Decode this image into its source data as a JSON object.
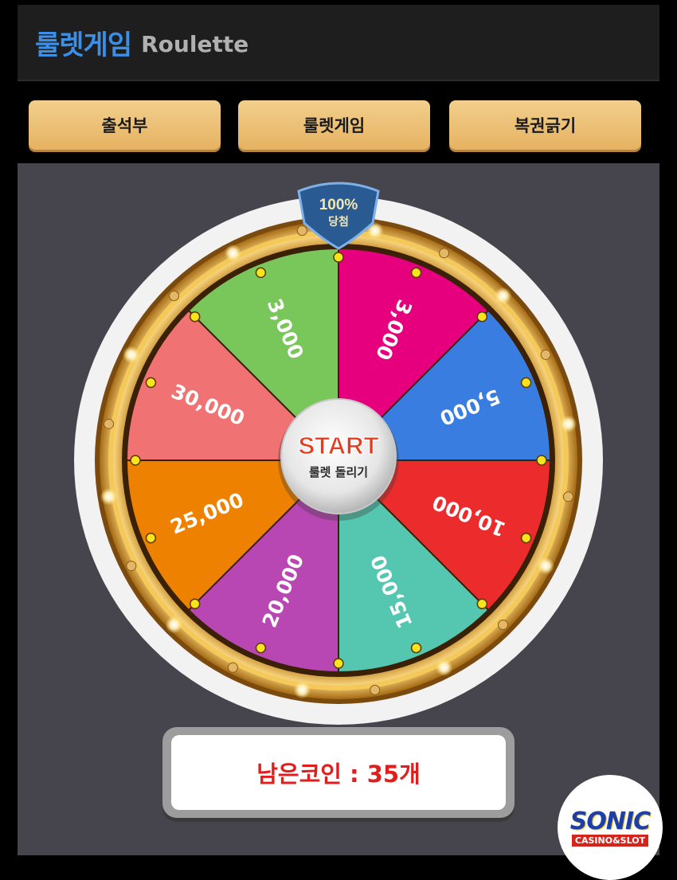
{
  "header": {
    "title_ko": "룰렛게임",
    "title_en": "Roulette"
  },
  "tabs": [
    {
      "label": "출석부"
    },
    {
      "label": "룰렛게임"
    },
    {
      "label": "복권긁기"
    }
  ],
  "wheel": {
    "badge_line1": "100%",
    "badge_line2": "당첨",
    "start_label": "START",
    "start_sub": "룰렛 돌리기",
    "segments": [
      {
        "label": "3,000",
        "color": "#e6007e"
      },
      {
        "label": "5,000",
        "color": "#3a7de0"
      },
      {
        "label": "10,000",
        "color": "#ec2c2c"
      },
      {
        "label": "15,000",
        "color": "#55c7b0"
      },
      {
        "label": "20,000",
        "color": "#b847b4"
      },
      {
        "label": "25,000",
        "color": "#ee8200"
      },
      {
        "label": "30,000",
        "color": "#f07272"
      },
      {
        "label": "3,000",
        "color": "#79c75a"
      }
    ]
  },
  "coins": {
    "label": "남은코인 : 35개"
  },
  "logo": {
    "main": "SONIC",
    "sub": "CASINO&SLOT"
  },
  "colors": {
    "accent": "#3a8fe8",
    "tab_gold": "#eebf74",
    "rim_gold": "#d9a23a",
    "coin_red": "#e01e1e"
  }
}
